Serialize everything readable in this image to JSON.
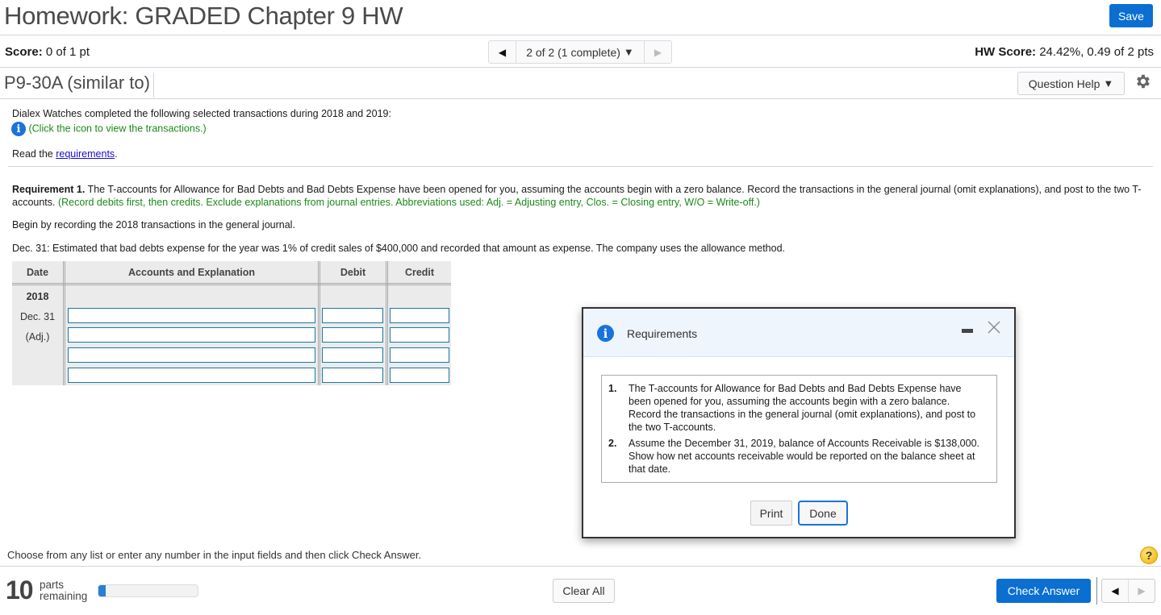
{
  "header": {
    "title": "Homework: GRADED Chapter 9 HW",
    "save_label": "Save"
  },
  "score_row": {
    "score_label": "Score:",
    "score_value": "0 of 1 pt",
    "question_nav": "2 of 2 (1 complete)",
    "hw_score_label": "HW Score:",
    "hw_score_value": "24.42%, 0.49 of 2 pts"
  },
  "problem_row": {
    "problem_id": "P9-30A (similar to)",
    "question_help_label": "Question Help"
  },
  "content": {
    "intro": "Dialex Watches completed the following selected transactions during 2018 and 2019:",
    "click_icon_text": "(Click the icon to view the transactions.)",
    "read_prefix": "Read the ",
    "requirements_link": "requirements",
    "read_suffix": ".",
    "req1_bold": "Requirement 1.",
    "req1_text": " The T-accounts for Allowance for Bad Debts and Bad Debts Expense have been opened for you, assuming the accounts begin with a zero balance. Record the transactions in the general journal (omit explanations), and post to the two T-accounts. ",
    "req1_green": "(Record debits first, then credits. Exclude explanations from journal entries. Abbreviations used: Adj. = Adjusting entry, Clos. = Closing entry, W/O = Write-off.)",
    "begin_text": "Begin by recording the 2018 transactions in the general journal.",
    "dec31_text": "Dec. 31: Estimated that bad debts expense for the year was 1% of credit sales of $400,000 and recorded that amount as expense. The company uses the allowance method."
  },
  "journal": {
    "headers": [
      "Date",
      "Accounts and Explanation",
      "Debit",
      "Credit"
    ],
    "year": "2018",
    "date": "Dec. 31",
    "entry_tag": "(Adj.)",
    "rows": [
      {
        "account": "",
        "debit": "",
        "credit": ""
      },
      {
        "account": "",
        "debit": "",
        "credit": ""
      },
      {
        "account": "",
        "debit": "",
        "credit": ""
      },
      {
        "account": "",
        "debit": "",
        "credit": ""
      }
    ]
  },
  "modal": {
    "title": "Requirements",
    "items": [
      {
        "num": "1.",
        "text": "The T-accounts for Allowance for Bad Debts and Bad Debts Expense have been opened for you, assuming the accounts begin with a zero balance. Record the transactions in the general journal (omit explanations), and post to the two T-accounts."
      },
      {
        "num": "2.",
        "text": "Assume the December 31, 2019, balance of Accounts Receivable is $138,000. Show how net accounts receivable would be reported on the balance sheet at that date."
      }
    ],
    "print_label": "Print",
    "done_label": "Done"
  },
  "footer": {
    "instructions": "Choose from any list or enter any number in the input fields and then click Check Answer.",
    "parts_count": "10",
    "parts_label_1": "parts",
    "parts_label_2": "remaining",
    "progress_percent": 7,
    "clear_all_label": "Clear All",
    "check_answer_label": "Check Answer",
    "help_symbol": "?"
  },
  "colors": {
    "accent_blue": "#0a6fd1",
    "instruction_green": "#1a8a1a",
    "link_blue": "#1a0dcc"
  }
}
